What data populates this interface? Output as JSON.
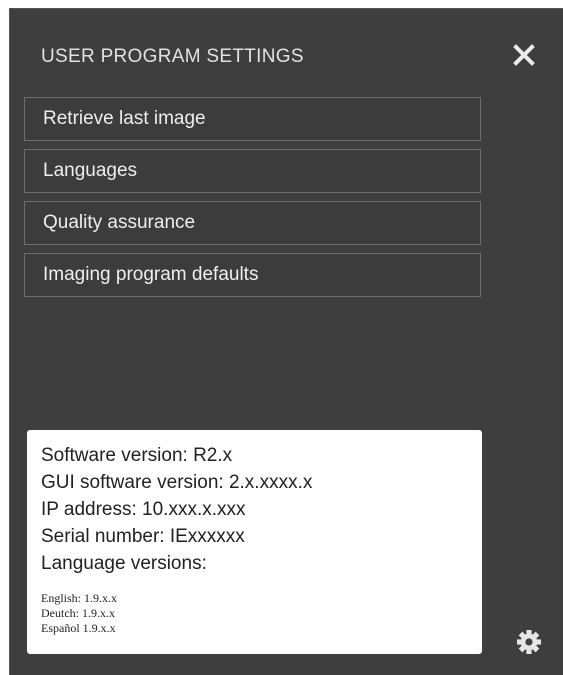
{
  "header": {
    "title": "USER PROGRAM SETTINGS",
    "close_icon": "close-icon"
  },
  "menu": {
    "items": [
      {
        "label": "Retrieve last image"
      },
      {
        "label": "Languages"
      },
      {
        "label": "Quality assurance"
      },
      {
        "label": "Imaging program defaults"
      }
    ]
  },
  "info": {
    "software_version": "Software version: R2.x",
    "gui_software_version": "GUI software version: 2.x.xxxx.x",
    "ip_address": "IP address: 10.xxx.x.xxx",
    "serial_number": "Serial number: IExxxxxx",
    "language_versions_label": "Language versions:",
    "languages": [
      {
        "text": "English: 1.9.x.x"
      },
      {
        "text": "Deutch: 1.9.x.x"
      },
      {
        "text": "Español 1.9.x.x"
      }
    ]
  },
  "footer": {
    "settings_icon": "gear-icon"
  },
  "colors": {
    "panel_background": "#3e3e3e",
    "menu_border": "#6c6c6c",
    "text_light": "#eeeeee",
    "info_background": "#ffffff"
  }
}
